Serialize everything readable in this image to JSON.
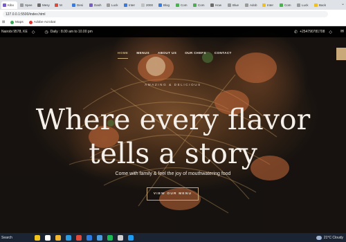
{
  "browser": {
    "tabs": [
      {
        "label": "Kibo",
        "color": "#7a5cc8"
      },
      {
        "label": "Spee",
        "color": "#9a9a9a"
      },
      {
        "label": "Mesy",
        "color": "#6b6b6b"
      },
      {
        "label": "M",
        "color": "#e04a3a"
      },
      {
        "label": "Desi",
        "color": "#3a7be0"
      },
      {
        "label": "Dash",
        "color": "#7a5cc8"
      },
      {
        "label": "Luck",
        "color": "#9a9a9a"
      },
      {
        "label": "Inter",
        "color": "#3a7be0"
      },
      {
        "label": "2000",
        "color": "#c0c0c0"
      },
      {
        "label": "Blog",
        "color": "#3a7be0"
      },
      {
        "label": "Com",
        "color": "#4caf50"
      },
      {
        "label": "Com",
        "color": "#4caf50"
      },
      {
        "label": "How",
        "color": "#6b6b6b"
      },
      {
        "label": "Blue",
        "color": "#9a9a9a"
      },
      {
        "label": "Adob",
        "color": "#9a9a9a"
      },
      {
        "label": "Inter",
        "color": "#f0c020"
      },
      {
        "label": "Com",
        "color": "#4caf50"
      },
      {
        "label": "Luck",
        "color": "#9a9a9a"
      },
      {
        "label": "Back",
        "color": "#f0c020"
      }
    ],
    "active_tab_index": 0,
    "url": "127.0.0.1:5500/index.html",
    "bookmarks": [
      {
        "label": "Maps",
        "color": "#34a853"
      },
      {
        "label": "Adobe Acrobat",
        "color": "#e0312b"
      }
    ]
  },
  "site": {
    "topbar": {
      "location": "Nairobi 9578, KE",
      "hours": "Daily : 8.00 am to 10.00 pm",
      "phone": "+254790781708"
    },
    "nav": [
      {
        "label": "HOME",
        "active": true
      },
      {
        "label": "MENUS",
        "active": false
      },
      {
        "label": "ABOUT US",
        "active": false
      },
      {
        "label": "OUR CHEFS",
        "active": false
      },
      {
        "label": "CONTACT",
        "active": false
      }
    ],
    "hero": {
      "subtitle": "AMAZING & DELICIOUS",
      "headline_line1": "Where every flavor",
      "headline_line2": "tells a story",
      "tagline": "Come with family & feel the joy of mouthwatering food",
      "cta": "VIEW OUR MENU"
    },
    "accent": "#c8a97a"
  },
  "taskbar": {
    "search": "Search",
    "apps": [
      {
        "name": "weather-pinwheel-icon",
        "color": "#f2c31b"
      },
      {
        "name": "task-view-icon",
        "color": "#ffffff"
      },
      {
        "name": "file-explorer-icon",
        "color": "#f2b632"
      },
      {
        "name": "edge-icon",
        "color": "#2b9de0"
      },
      {
        "name": "chrome-icon",
        "color": "#e04a3a"
      },
      {
        "name": "mail-icon",
        "color": "#2b7be0"
      },
      {
        "name": "store-icon",
        "color": "#4a9ee0"
      },
      {
        "name": "spotify-icon",
        "color": "#1db954"
      },
      {
        "name": "chatgpt-icon",
        "color": "#d0d0d0"
      },
      {
        "name": "vscode-icon",
        "color": "#1f9cf0"
      }
    ],
    "weather": "21°C  Cloudy"
  }
}
